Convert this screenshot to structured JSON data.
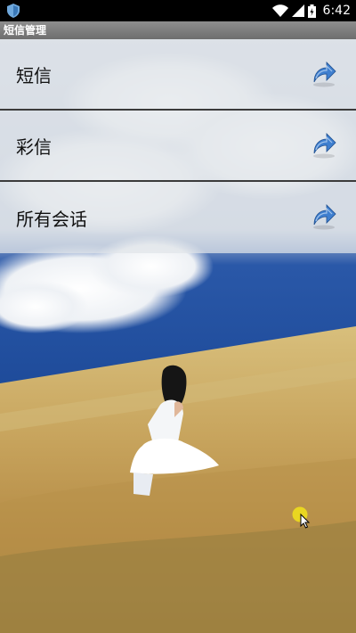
{
  "status_bar": {
    "time": "6:42",
    "icons": [
      "shield-icon",
      "wifi-icon",
      "signal-icon",
      "battery-icon"
    ]
  },
  "title_bar": {
    "title": "短信管理"
  },
  "menu": {
    "items": [
      {
        "label": "短信",
        "icon": "forward-arrow-icon"
      },
      {
        "label": "彩信",
        "icon": "forward-arrow-icon"
      },
      {
        "label": "所有会话",
        "icon": "forward-arrow-icon"
      }
    ]
  },
  "colors": {
    "status_bar_bg": "#000000",
    "title_bar_bg": "#7d7d7d",
    "menu_item_bg": "#e1e4e9",
    "menu_divider": "#3b3b3b",
    "arrow_blue": "#3f7fcf",
    "sky_blue": "#1f4fa0",
    "wheat": "#c9a45a"
  }
}
